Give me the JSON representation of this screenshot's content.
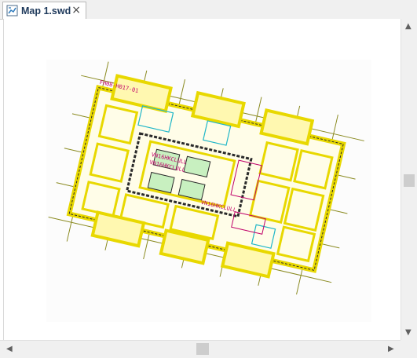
{
  "tab": {
    "label": "Map 1.swd",
    "icon": "map-document-icon",
    "close_icon": "close-icon"
  },
  "scrollbars": {
    "vertical": {
      "up_glyph": "▲",
      "down_glyph": "▼"
    },
    "horizontal": {
      "left_glyph": "◀",
      "right_glyph": "▶"
    }
  },
  "map": {
    "labels": [
      "FH08-H017-01",
      "VN16HKCLULL",
      "VN16HKCLULL",
      "VN16HKCLULL"
    ],
    "colors": {
      "primary": "#e8d800",
      "outline": "#2a2a2a",
      "accent": "#c0006a",
      "cyan": "#1fb6c8"
    }
  }
}
